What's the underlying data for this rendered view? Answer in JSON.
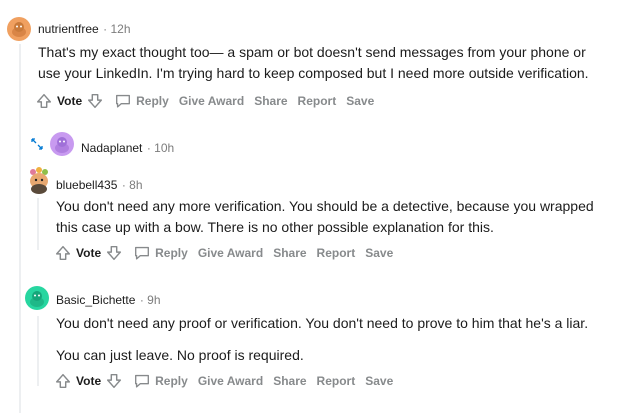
{
  "comments": [
    {
      "username": "nutrientfree",
      "time": "· 12h",
      "paragraphs": [
        "That's my exact thought too— a spam or bot doesn't send messages from your phone or use your LinkedIn. I'm trying hard to keep composed but I need more outside verification."
      ],
      "actions": {
        "vote": "Vote",
        "reply": "Reply",
        "award": "Give Award",
        "share": "Share",
        "report": "Report",
        "save": "Save"
      }
    },
    {
      "username": "Nadaplanet",
      "time": "· 10h",
      "collapsed": true
    },
    {
      "username": "bluebell435",
      "time": "· 8h",
      "paragraphs": [
        "You don't need any more verification. You should be a detective, because you wrapped this case up with a bow. There is no other possible explanation for this."
      ],
      "actions": {
        "vote": "Vote",
        "reply": "Reply",
        "award": "Give Award",
        "share": "Share",
        "report": "Report",
        "save": "Save"
      }
    },
    {
      "username": "Basic_Bichette",
      "time": "· 9h",
      "paragraphs": [
        "You don't need any proof or verification. You don't need to prove to him that he's a liar.",
        "You can just leave. No proof is required."
      ],
      "actions": {
        "vote": "Vote",
        "reply": "Reply",
        "award": "Give Award",
        "share": "Share",
        "report": "Report",
        "save": "Save"
      }
    }
  ],
  "icons": {
    "upvote": "upvote-arrow-icon",
    "downvote": "downvote-arrow-icon",
    "reply": "speech-bubble-icon",
    "expand": "expand-arrows-icon"
  },
  "colors": {
    "action_gray": "#878a8c",
    "thread_line": "#edeff1",
    "avatar_orange": "#f0a060",
    "avatar_purple": "#c89af0",
    "avatar_teal": "#27d6a0"
  }
}
